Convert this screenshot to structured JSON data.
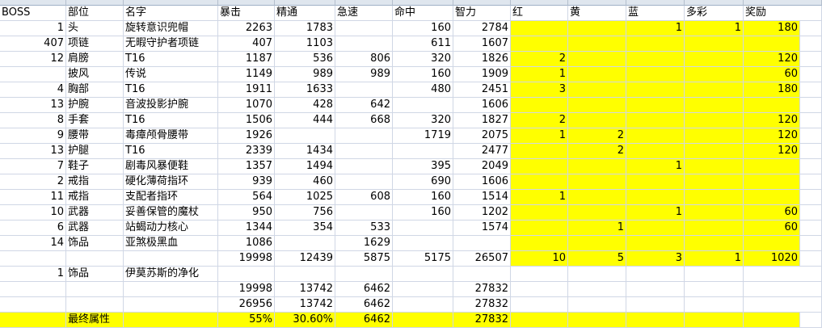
{
  "sheet": {
    "headers": [
      "BOSS",
      "部位",
      "名字",
      "暴击",
      "精通",
      "急速",
      "命中",
      "智力",
      "红",
      "黄",
      "蓝",
      "多彩",
      "奖励"
    ],
    "rows": [
      [
        "1",
        "头",
        "旋转意识兜帽",
        "2263",
        "1783",
        "",
        "160",
        "2784",
        "",
        "",
        "1",
        "1",
        "180"
      ],
      [
        "407",
        "项链",
        "无暇守护者项链",
        "407",
        "1103",
        "",
        "611",
        "1607",
        "",
        "",
        "",
        "",
        ""
      ],
      [
        "12",
        "肩膀",
        "T16",
        "1187",
        "536",
        "806",
        "320",
        "1826",
        "2",
        "",
        "",
        "",
        "120"
      ],
      [
        "",
        "披风",
        "传说",
        "1149",
        "989",
        "989",
        "160",
        "1909",
        "1",
        "",
        "",
        "",
        "60"
      ],
      [
        "4",
        "胸部",
        "T16",
        "1911",
        "1633",
        "",
        "480",
        "2451",
        "3",
        "",
        "",
        "",
        "180"
      ],
      [
        "13",
        "护腕",
        "音波投影护腕",
        "1070",
        "428",
        "642",
        "",
        "1606",
        "",
        "",
        "",
        "",
        ""
      ],
      [
        "8",
        "手套",
        "T16",
        "1506",
        "444",
        "668",
        "320",
        "1827",
        "2",
        "",
        "",
        "",
        "120"
      ],
      [
        "9",
        "腰带",
        "毒瘴颅骨腰带",
        "1926",
        "",
        "",
        "1719",
        "2075",
        "1",
        "2",
        "",
        "",
        "120"
      ],
      [
        "13",
        "护腿",
        "T16",
        "2339",
        "1434",
        "",
        "",
        "2477",
        "",
        "2",
        "",
        "",
        "120"
      ],
      [
        "7",
        "鞋子",
        "剧毒风暴便鞋",
        "1357",
        "1494",
        "",
        "395",
        "2049",
        "",
        "",
        "1",
        "",
        ""
      ],
      [
        "2",
        "戒指",
        "硬化薄荷指环",
        "939",
        "460",
        "",
        "690",
        "1606",
        "",
        "",
        "",
        "",
        ""
      ],
      [
        "11",
        "戒指",
        "支配者指环",
        "564",
        "1025",
        "608",
        "160",
        "1514",
        "1",
        "",
        "",
        "",
        ""
      ],
      [
        "10",
        "武器",
        "妥善保管的魔杖",
        "950",
        "756",
        "",
        "160",
        "1202",
        "",
        "",
        "1",
        "",
        "60"
      ],
      [
        "6",
        "武器",
        "站蝎动力核心",
        "1344",
        "354",
        "533",
        "",
        "1574",
        "",
        "1",
        "",
        "",
        "60"
      ],
      [
        "14",
        "饰品",
        "亚煞极黑血",
        "1086",
        "",
        "1629",
        "",
        "",
        "",
        "",
        "",
        "",
        ""
      ],
      [
        "",
        "",
        "",
        "19998",
        "12439",
        "5875",
        "5175",
        "26507",
        "10",
        "5",
        "3",
        "1",
        "1020"
      ],
      [
        "1",
        "饰品",
        "伊莫苏斯的净化",
        "",
        "",
        "",
        "",
        "",
        "",
        "",
        "",
        "",
        ""
      ],
      [
        "",
        "",
        "",
        "19998",
        "13742",
        "6462",
        "",
        "27832",
        "",
        "",
        "",
        "",
        ""
      ],
      [
        "",
        "",
        "",
        "26956",
        "13742",
        "6462",
        "",
        "27832",
        "",
        "",
        "",
        "",
        ""
      ],
      [
        "",
        "最终属性",
        "",
        "55%",
        "30.60%",
        "6462",
        "",
        "27832",
        "",
        "",
        "",
        "",
        ""
      ]
    ]
  }
}
